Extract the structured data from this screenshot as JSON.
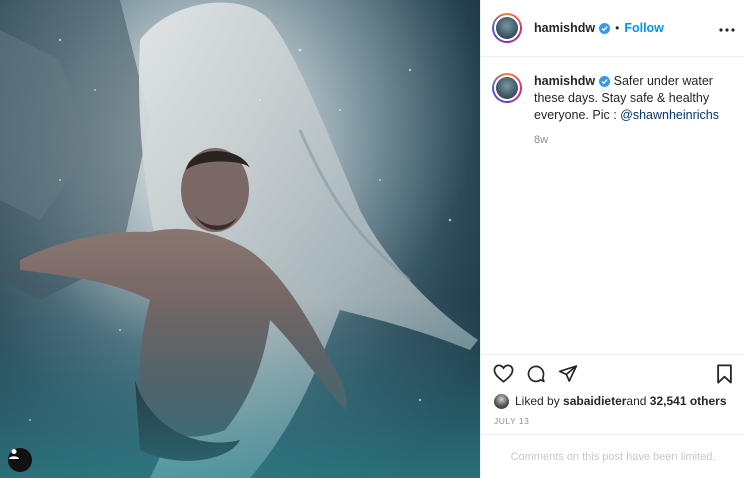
{
  "header": {
    "username": "hamishdw",
    "dot": "•",
    "follow_label": "Follow",
    "more_label": "•••"
  },
  "caption": {
    "username": "hamishdw",
    "text": "Safer under water these days. Stay safe & healthy everyone. Pic : ",
    "mention": "@shawnheinrichs",
    "age": "8w"
  },
  "likes": {
    "prefix": "Liked by ",
    "user": "sabaidieter",
    "middle": " and ",
    "count": "32,541 others"
  },
  "date": "JULY 13",
  "comments_limited": "Comments on this post have been limited.",
  "icons": {
    "like": "heart-icon",
    "comment": "comment-icon",
    "share": "share-icon",
    "save": "bookmark-icon",
    "tag": "user-tag-icon",
    "verified": "verified-badge-icon"
  },
  "colors": {
    "follow": "#0095f6",
    "verified": "#3897f0",
    "mention": "#00376b",
    "muted": "#8e8e8e"
  }
}
